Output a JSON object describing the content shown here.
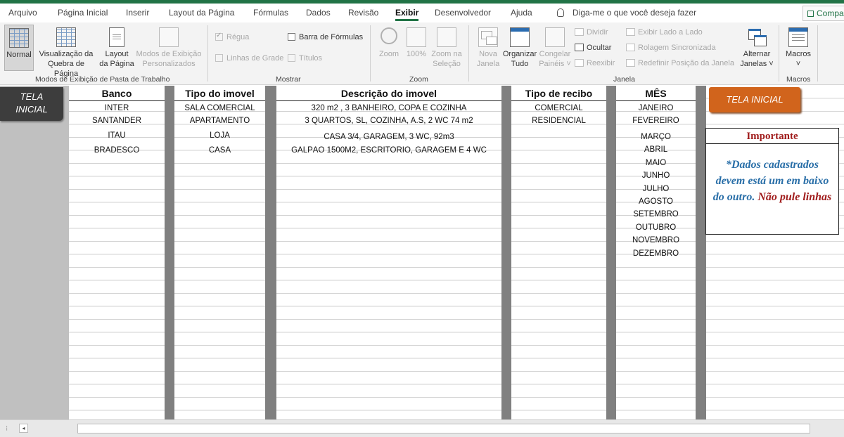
{
  "tabs": [
    {
      "label": "Arquivo",
      "active": false
    },
    {
      "label": "Página Inicial",
      "active": false
    },
    {
      "label": "Inserir",
      "active": false
    },
    {
      "label": "Layout da Página",
      "active": false
    },
    {
      "label": "Fórmulas",
      "active": false
    },
    {
      "label": "Dados",
      "active": false
    },
    {
      "label": "Revisão",
      "active": false
    },
    {
      "label": "Exibir",
      "active": true
    },
    {
      "label": "Desenvolvedor",
      "active": false
    },
    {
      "label": "Ajuda",
      "active": false
    }
  ],
  "tell_me": "Diga-me o que você deseja fazer",
  "share_label": "Compa",
  "ribbon": {
    "modes": {
      "normal": "Normal",
      "page_break_1": "Visualização da",
      "page_break_2": "Quebra de Página",
      "layout_1": "Layout",
      "layout_2": "da Página",
      "custom_1": "Modos de Exibição",
      "custom_2": "Personalizados",
      "group": "Modos de Exibição de Pasta de Trabalho"
    },
    "show": {
      "ruler": "Régua",
      "formula_bar": "Barra de Fórmulas",
      "gridlines": "Linhas de Grade",
      "headings": "Títulos",
      "group": "Mostrar"
    },
    "zoom": {
      "zoom": "Zoom",
      "hundred": "100%",
      "sel_1": "Zoom na",
      "sel_2": "Seleção",
      "group": "Zoom"
    },
    "window": {
      "new_1": "Nova",
      "new_2": "Janela",
      "arrange_1": "Organizar",
      "arrange_2": "Tudo",
      "freeze_1": "Congelar",
      "freeze_2": "Painéis ˅",
      "split": "Dividir",
      "hide": "Ocultar",
      "unhide": "Reexibir",
      "side_by_side": "Exibir Lado a Lado",
      "sync_scroll": "Rolagem Sincronizada",
      "reset_pos": "Redefinir Posição da Janela",
      "switch_1": "Alternar",
      "switch_2": "Janelas ˅",
      "group": "Janela"
    },
    "macros": {
      "label": "Macros",
      "arrow": "˅",
      "group": "Macros"
    }
  },
  "sheet": {
    "tela_inicial_left_1": "TELA",
    "tela_inicial_left_2": "INICIAL",
    "tela_inicial_right": "TELA INICIAL",
    "importante_title": "Importante",
    "importante_blue": "*Dados cadastrados devem está um em baixo do outro.",
    "importante_red": "Não pule linhas",
    "banco": {
      "header": "Banco",
      "rows": [
        "INTER",
        "SANTANDER",
        "ITAÚ",
        "BRADESCO"
      ]
    },
    "tipo_imovel": {
      "header": "Tipo do imovel",
      "rows": [
        "SALA COMERCIAL",
        "APARTAMENTO",
        "LOJA",
        "CASA"
      ]
    },
    "descricao": {
      "header": "Descrição do imovel",
      "rows": [
        "320 m2 , 3 BANHEIRO, COPA E COZINHA",
        "3 QUARTOS, SL, COZINHA, A.S, 2 WC 74 m2",
        "CASA 3/4,  GARAGEM, 3 WC, 92m3",
        "GALPÃO 1500M2, ESCRITORIO, GARAGEM E 4 WC"
      ]
    },
    "tipo_recibo": {
      "header": "Tipo de recibo",
      "rows": [
        "COMERCIAL",
        "RESIDENCIAL"
      ]
    },
    "mes": {
      "header": "MÊS",
      "rows": [
        "JANEIRO",
        "FEVEREIRO",
        "MARÇO",
        "ABRIL",
        "MAIO",
        "JUNHO",
        "JULHO",
        "AGOSTO",
        "SETEMBRO",
        "OUTUBRO",
        "NOVEMBRO",
        "DEZEMBRO"
      ]
    }
  },
  "status": {
    "dots": "⁝",
    "scroll_left": "◂"
  }
}
